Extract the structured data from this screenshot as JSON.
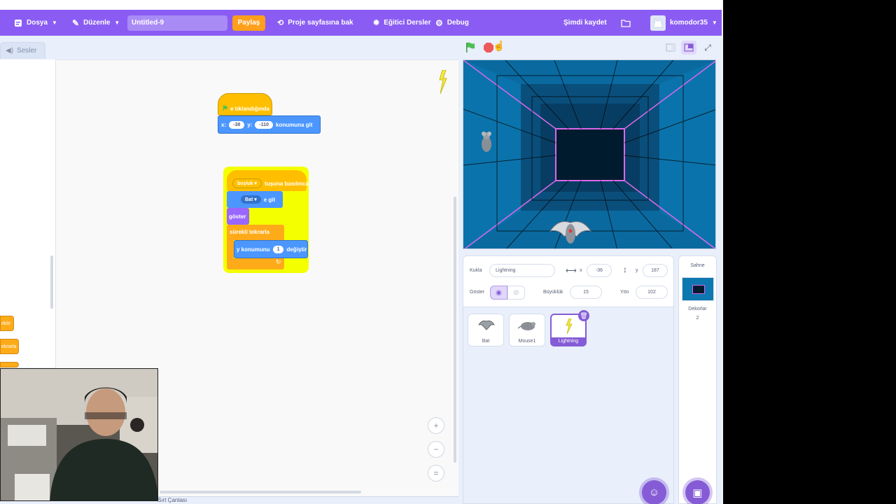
{
  "menu": {
    "file": "Dosya",
    "edit": "Düzenle",
    "project_title": "Untitled-9",
    "share": "Paylaş",
    "see_project_page": "Proje sayfasına bak",
    "tutorials": "Eğitici Dersler",
    "debug": "Debug",
    "save_now": "Şimdi kaydet",
    "username": "komodor35"
  },
  "tabs": {
    "sounds": "Sesler"
  },
  "palette": {
    "block1": "ekle",
    "block2": "ekrarla"
  },
  "scripts": {
    "hat1": "e tıklandığında",
    "goto_x_label": "x:",
    "goto_x": "-38",
    "goto_y_label": "y:",
    "goto_y": "-110",
    "goto_text": "konumuna git",
    "hat2_key": "boşluk",
    "hat2_text": "tuşuna basılınca",
    "goto_target": "Bat",
    "goto2_text": "e git",
    "show": "göster",
    "forever": "sürekli tekrarla",
    "change_y_label": "y konumunu",
    "change_y_value": "1",
    "change_y_text": "değiştir"
  },
  "zoom": {
    "zoom_in": "+",
    "zoom_out": "−",
    "reset": "="
  },
  "backpack": {
    "label": "Sırt Çantası"
  },
  "sprite_info": {
    "sprite_label": "Kukla",
    "sprite_name": "Lightning",
    "x_label": "x",
    "x_value": "-36",
    "y_label": "y",
    "y_value": "187",
    "show_label": "Göster",
    "size_label": "Büyüklük",
    "size_value": "15",
    "direction_label": "Yön",
    "direction_value": "102"
  },
  "sprites": [
    {
      "name": "Bat"
    },
    {
      "name": "Mouse1"
    },
    {
      "name": "Lightning",
      "selected": true
    }
  ],
  "stage_panel": {
    "title": "Sahne",
    "backdrops_label": "Dekorlar",
    "backdrops_count": "2"
  },
  "colors": {
    "menu_bg": "#8a5cf3",
    "accent": "#855cd6",
    "events": "#ffbf00",
    "motion": "#4c97ff",
    "looks": "#9966ff",
    "control": "#ffab19"
  }
}
